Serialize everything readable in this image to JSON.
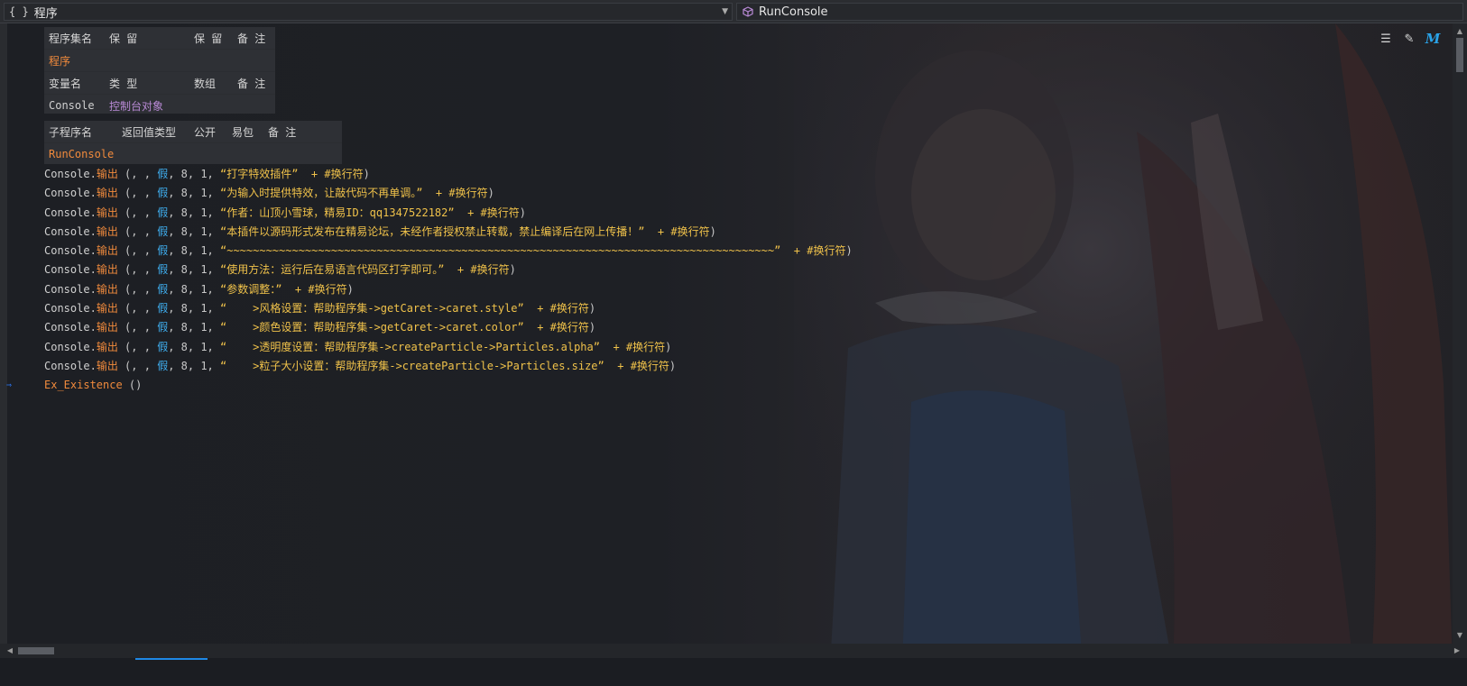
{
  "nav": {
    "left_icon": "{ }",
    "left_value": "程序",
    "right_value": "RunConsole",
    "right_icon": "cube-icon"
  },
  "assembly_table": {
    "headers": [
      "程序集名",
      "保 留",
      "保 留",
      "备 注"
    ],
    "name": "程序",
    "var_headers": [
      "变量名",
      "类 型",
      "数组",
      "备 注"
    ],
    "var_name": "Console",
    "var_type": "控制台对象"
  },
  "sub_table": {
    "headers": [
      "子程序名",
      "返回值类型",
      "公开",
      "易包",
      "备 注"
    ],
    "name": "RunConsole"
  },
  "code": {
    "object": "Console",
    "method": "输出",
    "args_prefix": " (, , ",
    "bool_kw": "假",
    "args_nums": ", 8, 1, ",
    "plus": "+",
    "newline": "#换行符",
    "strings": [
      "“打字特效插件”",
      "“为输入时提供特效，让敲代码不再单调。”",
      "“作者：山顶小雪球，精易ID：qq1347522182”",
      "“本插件以源码形式发布在精易论坛，未经作者授权禁止转载，禁止编译后在网上传播！”",
      "“~~~~~~~~~~~~~~~~~~~~~~~~~~~~~~~~~~~~~~~~~~~~~~~~~~~~~~~~~~~~~~~~~~~~~~~~~~~~~~~~~~~~”",
      "“使用方法：运行后在易语言代码区打字即可。”",
      "“参数调整：”",
      "“    >风格设置：帮助程序集->getCaret->caret.style”",
      "“    >颜色设置：帮助程序集->getCaret->caret.color”",
      "“    >透明度设置：帮助程序集->createParticle->Particles.alpha”",
      "“    >粒子大小设置：帮助程序集->createParticle->Particles.size”"
    ],
    "last_call": "Ex_Existence",
    "last_call_args": " ()"
  },
  "toolbar_icons": [
    "format-icon",
    "edit-check-icon",
    "m-logo-icon"
  ]
}
